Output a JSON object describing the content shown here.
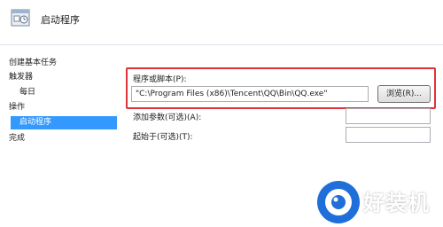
{
  "header": {
    "title": "启动程序"
  },
  "steps": [
    {
      "label": "创建基本任务"
    },
    {
      "label": "触发器"
    },
    {
      "label": "每日"
    },
    {
      "label": "操作"
    },
    {
      "label": "启动程序"
    },
    {
      "label": "完成"
    }
  ],
  "form": {
    "program_label": "程序或脚本(P):",
    "program_value": "\"C:\\Program Files (x86)\\Tencent\\QQ\\Bin\\QQ.exe\"",
    "browse_label": "浏览(R)...",
    "args_label": "添加参数(可选)(A):",
    "args_value": "",
    "startin_label": "起始于(可选)(T):",
    "startin_value": ""
  },
  "watermark": {
    "text": "好装机"
  },
  "colors": {
    "highlight_border": "#e0323a",
    "selected_step": "#3399ff",
    "watermark_blue": "#1e6fd9"
  }
}
